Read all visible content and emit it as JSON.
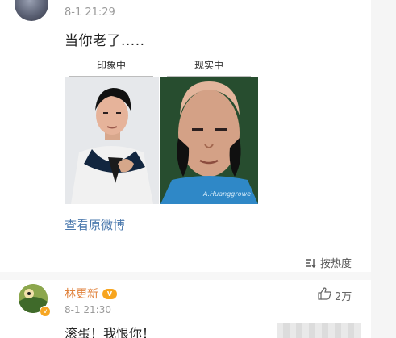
{
  "post": {
    "time": "8-1 21:29",
    "text": "当你老了.....",
    "image_labels": [
      "印象中",
      "现实中"
    ],
    "watermark": "A.Huanggrowe",
    "view_original": "查看原微博"
  },
  "comments_header": {
    "sort_label": "按热度",
    "sort_icon": "sort-icon"
  },
  "comment": {
    "author": "林更新",
    "badge": "vip",
    "time": "8-1 21:30",
    "text": "滚蛋！我恨你！",
    "likes": "2万",
    "like_icon": "thumbs-up-icon"
  },
  "colors": {
    "link": "#4a78ad",
    "username": "#e0823c",
    "badge": "#f7a51f"
  }
}
